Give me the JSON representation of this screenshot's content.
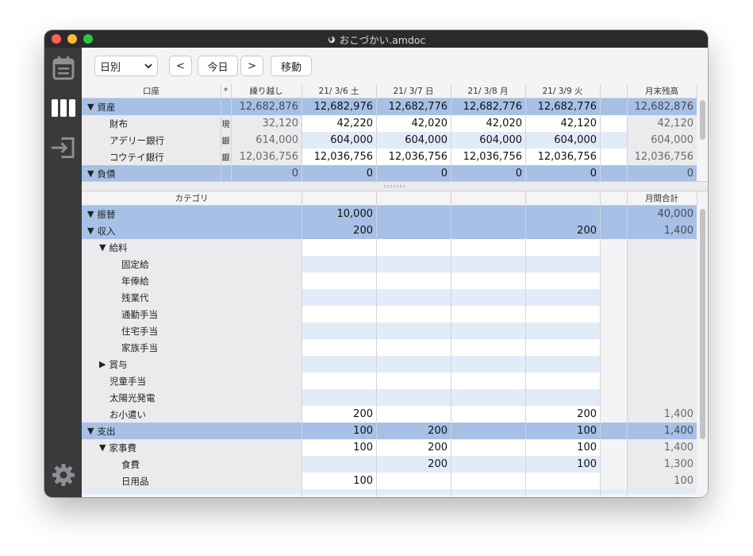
{
  "window": {
    "title": "おこづかい.amdoc"
  },
  "toolbar": {
    "period": "日別",
    "prev": "<",
    "today": "今日",
    "next": ">",
    "move": "移動"
  },
  "accounts": {
    "headers": [
      "口座",
      "*",
      "繰り越し",
      "21/ 3/6 土",
      "21/ 3/7 日",
      "21/ 3/8 月",
      "21/ 3/9 火",
      "",
      "月末残高"
    ],
    "rows": [
      {
        "label": "資産",
        "kind": "",
        "values": [
          "12,682,876",
          "12,682,976",
          "12,682,776",
          "12,682,776",
          "12,682,776",
          "",
          "12,682,876"
        ],
        "type": "group",
        "expand": "▼"
      },
      {
        "label": "財布",
        "kind": "現",
        "values": [
          "32,120",
          "42,220",
          "42,020",
          "42,020",
          "42,120",
          "",
          "42,120"
        ],
        "type": "item"
      },
      {
        "label": "アデリー銀行",
        "kind": "銀",
        "values": [
          "614,000",
          "604,000",
          "604,000",
          "604,000",
          "604,000",
          "",
          "604,000"
        ],
        "type": "item"
      },
      {
        "label": "コウテイ銀行",
        "kind": "銀",
        "values": [
          "12,036,756",
          "12,036,756",
          "12,036,756",
          "12,036,756",
          "12,036,756",
          "",
          "12,036,756"
        ],
        "type": "item"
      },
      {
        "label": "負債",
        "kind": "",
        "values": [
          "0",
          "0",
          "0",
          "0",
          "0",
          "",
          "0"
        ],
        "type": "group",
        "expand": "▼"
      }
    ]
  },
  "categories": {
    "headers": [
      "カテゴリ",
      "",
      "",
      "",
      "",
      "",
      "月間合計"
    ],
    "rows": [
      {
        "label": "振替",
        "level": 0,
        "expand": "▼",
        "type": "group",
        "values": [
          "10,000",
          "",
          "",
          "",
          "",
          "40,000"
        ]
      },
      {
        "label": "収入",
        "level": 0,
        "expand": "▼",
        "type": "group",
        "values": [
          "200",
          "",
          "",
          "200",
          "",
          "1,400"
        ]
      },
      {
        "label": "給料",
        "level": 1,
        "expand": "▼",
        "type": "item",
        "values": [
          "",
          "",
          "",
          "",
          "",
          ""
        ]
      },
      {
        "label": "固定給",
        "level": 2,
        "expand": "",
        "type": "item",
        "values": [
          "",
          "",
          "",
          "",
          "",
          ""
        ]
      },
      {
        "label": "年俸給",
        "level": 2,
        "expand": "",
        "type": "item",
        "values": [
          "",
          "",
          "",
          "",
          "",
          ""
        ]
      },
      {
        "label": "残業代",
        "level": 2,
        "expand": "",
        "type": "item",
        "values": [
          "",
          "",
          "",
          "",
          "",
          ""
        ]
      },
      {
        "label": "通勤手当",
        "level": 2,
        "expand": "",
        "type": "item",
        "values": [
          "",
          "",
          "",
          "",
          "",
          ""
        ]
      },
      {
        "label": "住宅手当",
        "level": 2,
        "expand": "",
        "type": "item",
        "values": [
          "",
          "",
          "",
          "",
          "",
          ""
        ]
      },
      {
        "label": "家族手当",
        "level": 2,
        "expand": "",
        "type": "item",
        "values": [
          "",
          "",
          "",
          "",
          "",
          ""
        ]
      },
      {
        "label": "賞与",
        "level": 1,
        "expand": "▶",
        "type": "item",
        "values": [
          "",
          "",
          "",
          "",
          "",
          ""
        ]
      },
      {
        "label": "児童手当",
        "level": 1,
        "expand": "",
        "type": "item",
        "values": [
          "",
          "",
          "",
          "",
          "",
          ""
        ]
      },
      {
        "label": "太陽光発電",
        "level": 1,
        "expand": "",
        "type": "item",
        "values": [
          "",
          "",
          "",
          "",
          "",
          ""
        ]
      },
      {
        "label": "お小遣い",
        "level": 1,
        "expand": "",
        "type": "item",
        "values": [
          "200",
          "",
          "",
          "200",
          "",
          "1,400"
        ]
      },
      {
        "label": "支出",
        "level": 0,
        "expand": "▼",
        "type": "group",
        "values": [
          "100",
          "200",
          "",
          "100",
          "",
          "1,400"
        ]
      },
      {
        "label": "家事費",
        "level": 1,
        "expand": "▼",
        "type": "item",
        "values": [
          "100",
          "200",
          "",
          "100",
          "",
          "1,400"
        ]
      },
      {
        "label": "食費",
        "level": 2,
        "expand": "",
        "type": "item",
        "values": [
          "",
          "200",
          "",
          "100",
          "",
          "1,300"
        ]
      },
      {
        "label": "日用品",
        "level": 2,
        "expand": "",
        "type": "item",
        "values": [
          "100",
          "",
          "",
          "",
          "",
          "100"
        ]
      }
    ]
  },
  "colors": {
    "group_bg": "#a6c1e5",
    "stripe": "#e2ebf8",
    "label_bg": "#ebebed",
    "sidebar": "#3a3a3c",
    "titlebar": "#2b2b2d"
  },
  "sidebar_icons": [
    "calendar-icon",
    "columns-icon",
    "import-icon",
    "gear-icon"
  ]
}
